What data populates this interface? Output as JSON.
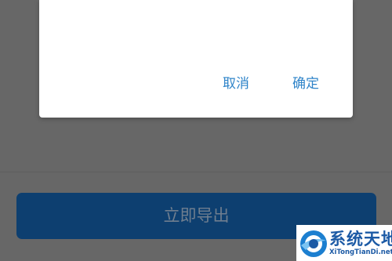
{
  "dialog": {
    "cancel_label": "取消",
    "confirm_label": "确定"
  },
  "main": {
    "export_button_label": "立即导出"
  },
  "watermark": {
    "title": "系统天地",
    "url": "XiTongTianDi.net"
  },
  "colors": {
    "overlay": "#676767",
    "dialog_button_text": "#2f84c9",
    "export_button_bg": "#0d3f70",
    "watermark_blue": "#1c5aa5"
  }
}
